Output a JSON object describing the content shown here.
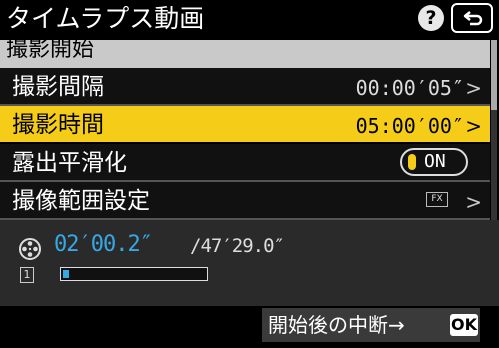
{
  "header": {
    "title": "タイムラプス動画",
    "help_label": "?",
    "back_icon": "return-arrow-icon"
  },
  "menu": {
    "section_label": "撮影開始",
    "rows": [
      {
        "label": "撮影間隔",
        "value": "00:00′05″",
        "chevron": ">"
      },
      {
        "label": "撮影時間",
        "value": "05:00′00″",
        "chevron": ">",
        "selected": true
      },
      {
        "label": "露出平滑化",
        "toggle": "ON"
      },
      {
        "label": "撮像範囲設定",
        "badge": "FX",
        "chevron": ">"
      }
    ]
  },
  "info": {
    "elapsed_time": "02′00.2″",
    "total_time": "/47′29.0″",
    "card_label": "1",
    "progress_fraction": 0.04
  },
  "footer": {
    "hint_text": "開始後の中断→",
    "ok_label": "OK"
  },
  "colors": {
    "accent_yellow": "#f5cd19",
    "accent_blue": "#37a8e6",
    "section_gray": "#c9c9c9"
  }
}
